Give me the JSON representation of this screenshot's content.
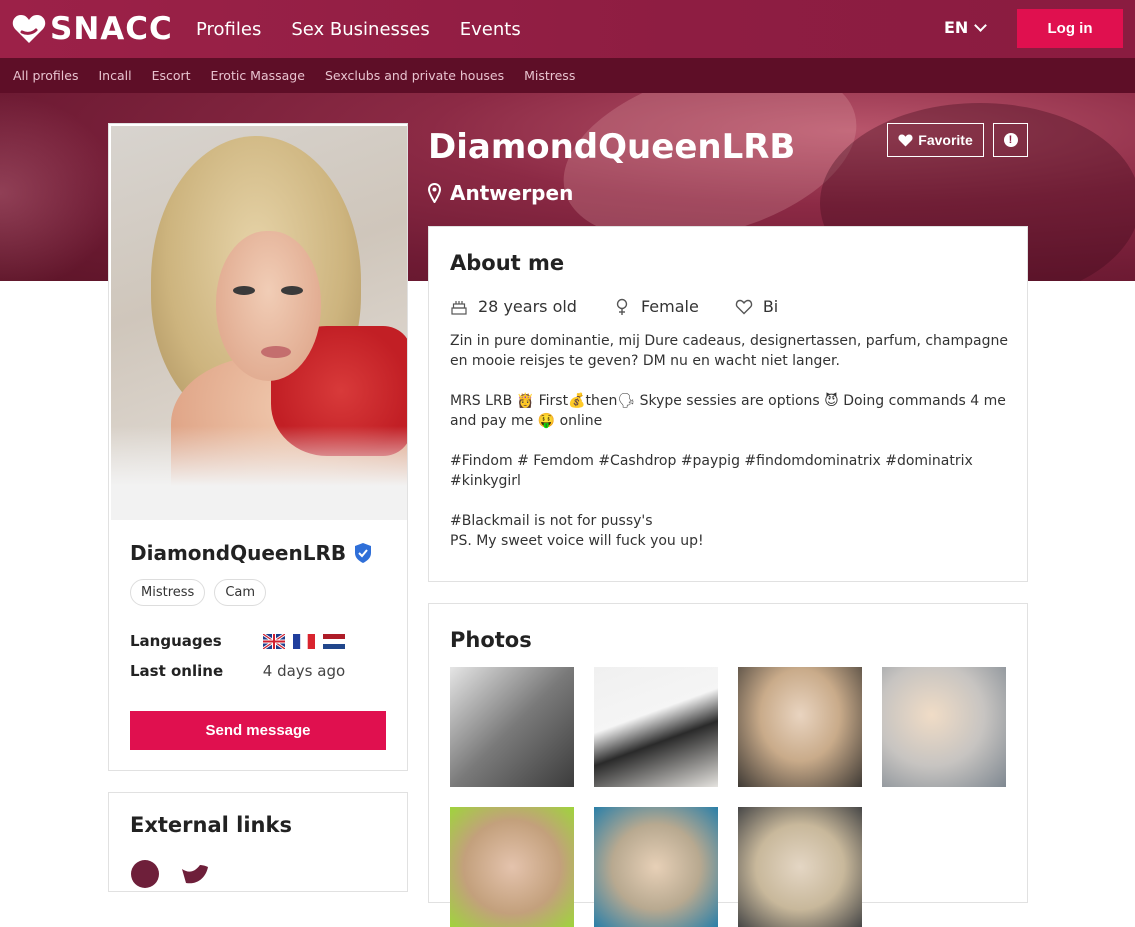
{
  "nav": {
    "brand": "SNACC",
    "links": [
      "Profiles",
      "Sex Businesses",
      "Events"
    ],
    "language": "EN",
    "login": "Log in"
  },
  "subnav": [
    "All profiles",
    "Incall",
    "Escort",
    "Erotic Massage",
    "Sexclubs and private houses",
    "Mistress"
  ],
  "profile": {
    "name": "DiamondQueenLRB",
    "location": "Antwerpen",
    "favorite_label": "Favorite",
    "tags": [
      "Mistress",
      "Cam"
    ],
    "languages_label": "Languages",
    "last_online_label": "Last online",
    "last_online": "4 days ago",
    "send_message": "Send message",
    "external_links_title": "External links"
  },
  "about": {
    "title": "About me",
    "age": "28 years old",
    "gender": "Female",
    "orientation": "Bi",
    "text": "Zin in pure dominantie, mij Dure cadeaus, designertassen, parfum, champagne en mooie reisjes te geven? DM nu en wacht niet langer.\n\nMRS LRB 👸 First💰then🗣 Skype sessies are options 😈 Doing commands 4 me and pay me 🤑 online\n\n#Findom # Femdom #Cashdrop #paypig #findomdominatrix #dominatrix #kinkygirl\n\n#Blackmail is not for pussy's\nPS. My sweet voice will fuck you up!"
  },
  "photos": {
    "title": "Photos"
  },
  "colors": {
    "brand": "#8e1d42",
    "accent": "#e0104f",
    "subnav": "#5e0e27"
  }
}
